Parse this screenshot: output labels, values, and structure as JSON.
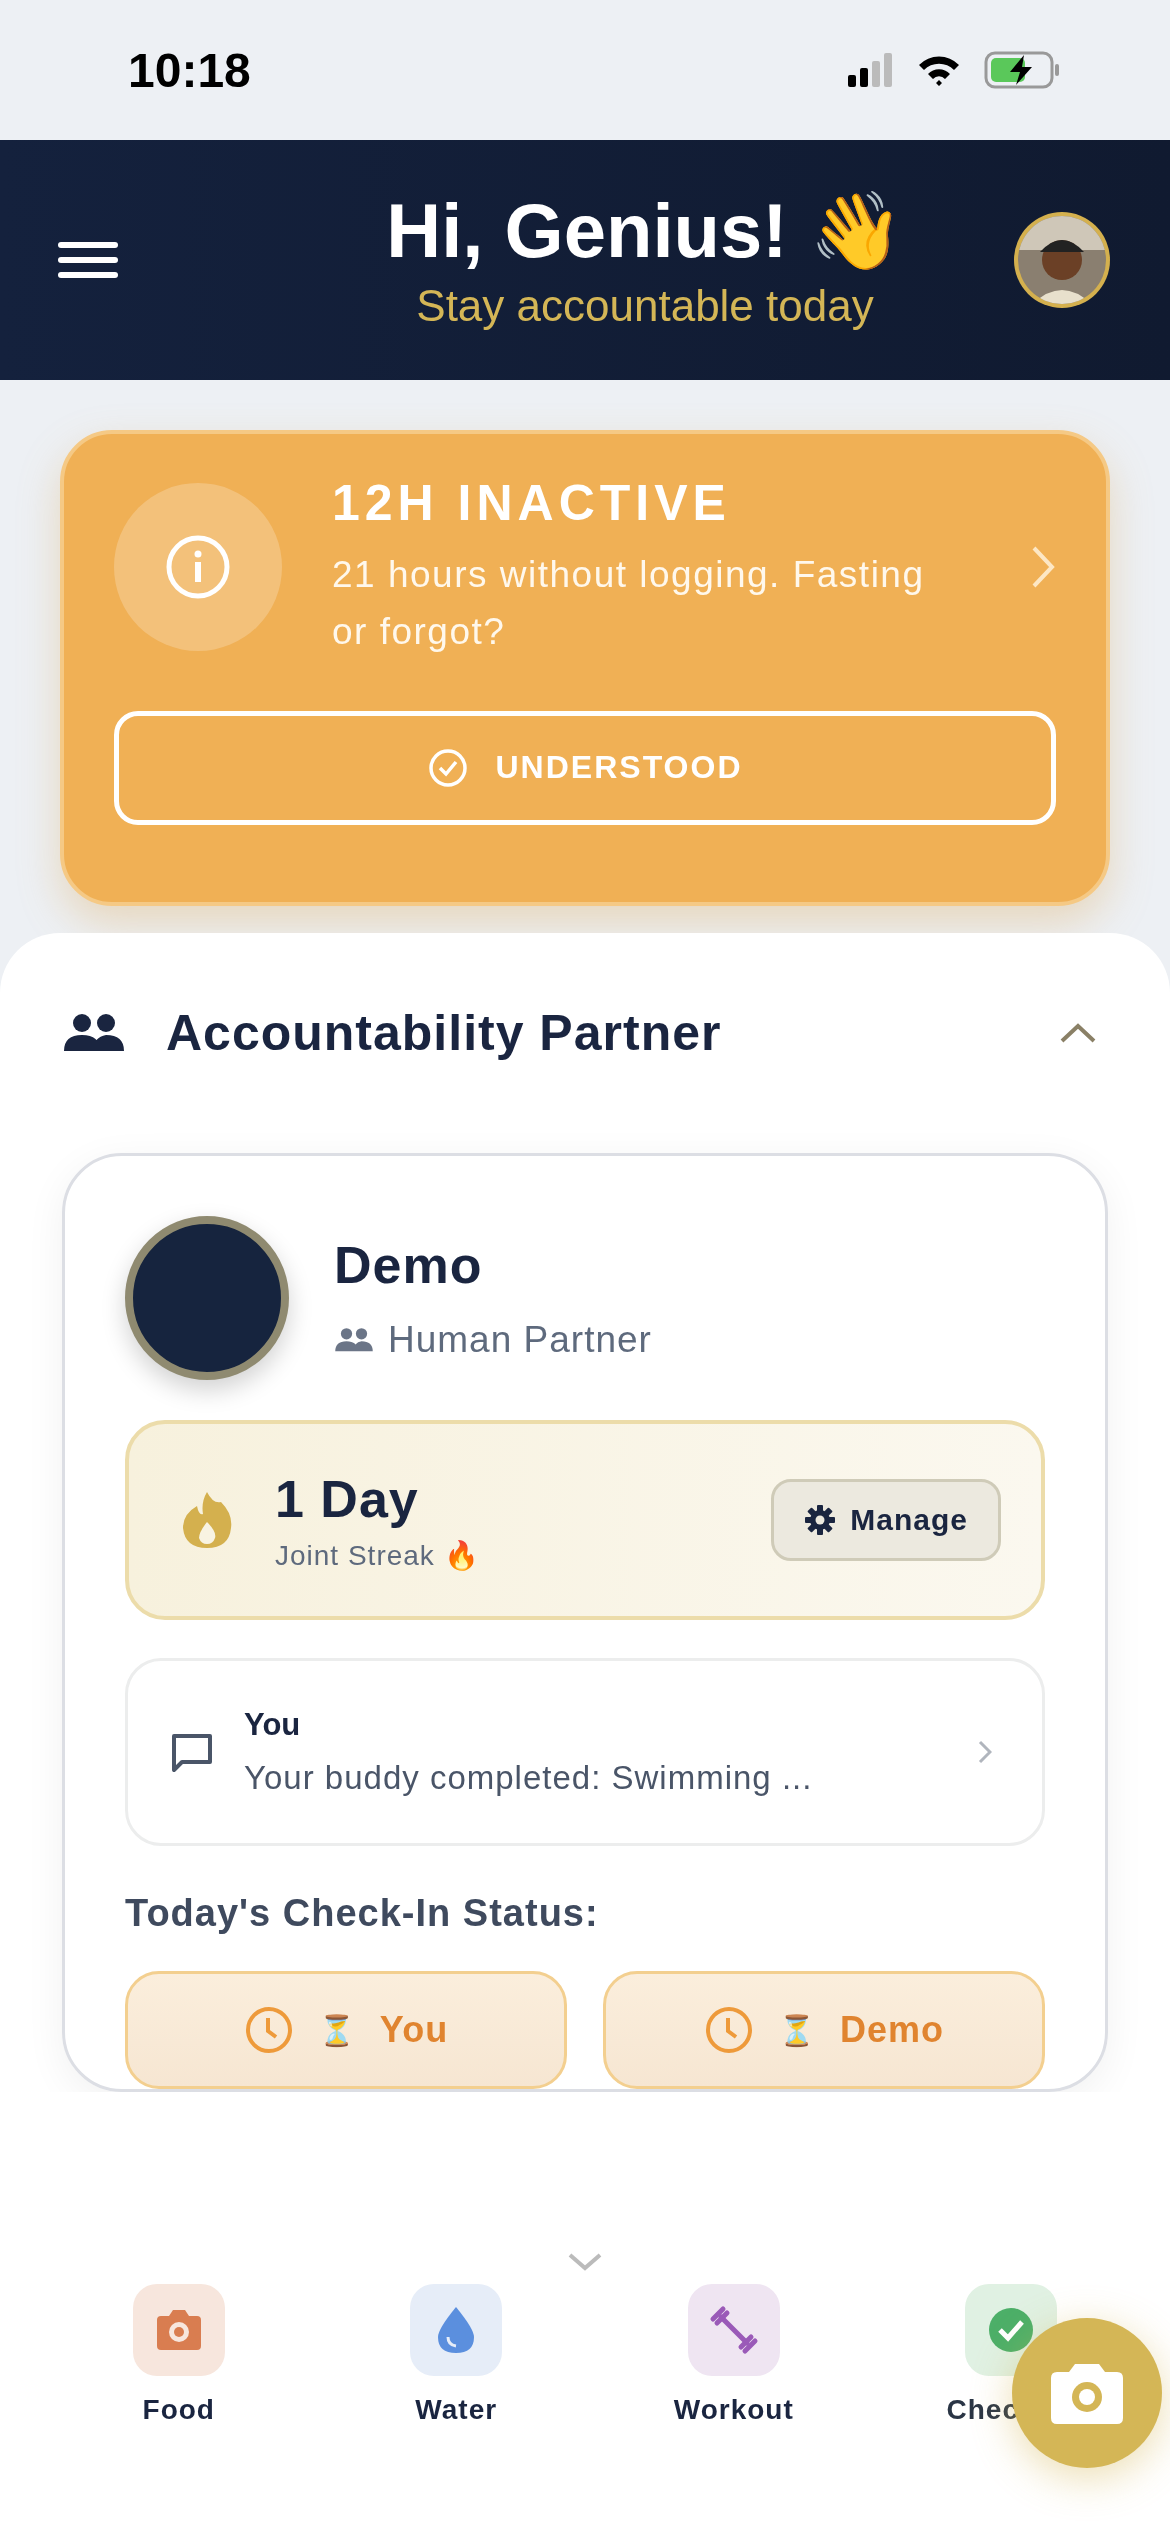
{
  "status_bar": {
    "time": "10:18"
  },
  "header": {
    "title": "Hi, Genius! 👋",
    "subtitle": "Stay accountable today"
  },
  "alert": {
    "title": "12H INACTIVE",
    "message": "21 hours without logging. Fasting or forgot?",
    "button": "UNDERSTOOD"
  },
  "partner_section": {
    "title": "Accountability Partner",
    "expanded": true,
    "partner": {
      "name": "Demo",
      "type": "Human Partner"
    },
    "streak": {
      "value": "1 Day",
      "label": "Joint Streak 🔥",
      "button": "Manage"
    },
    "message": {
      "sender": "You",
      "text": "Your buddy completed: Swimming ..."
    },
    "checkin_title": "Today's Check-In Status:",
    "checkins": [
      {
        "icon": "⏳",
        "name": "You"
      },
      {
        "icon": "⏳",
        "name": "Demo"
      }
    ]
  },
  "quick_actions": [
    {
      "kind": "food",
      "label": "Food"
    },
    {
      "kind": "water",
      "label": "Water"
    },
    {
      "kind": "workout",
      "label": "Workout"
    },
    {
      "kind": "checkin",
      "label": "Chec"
    }
  ]
}
